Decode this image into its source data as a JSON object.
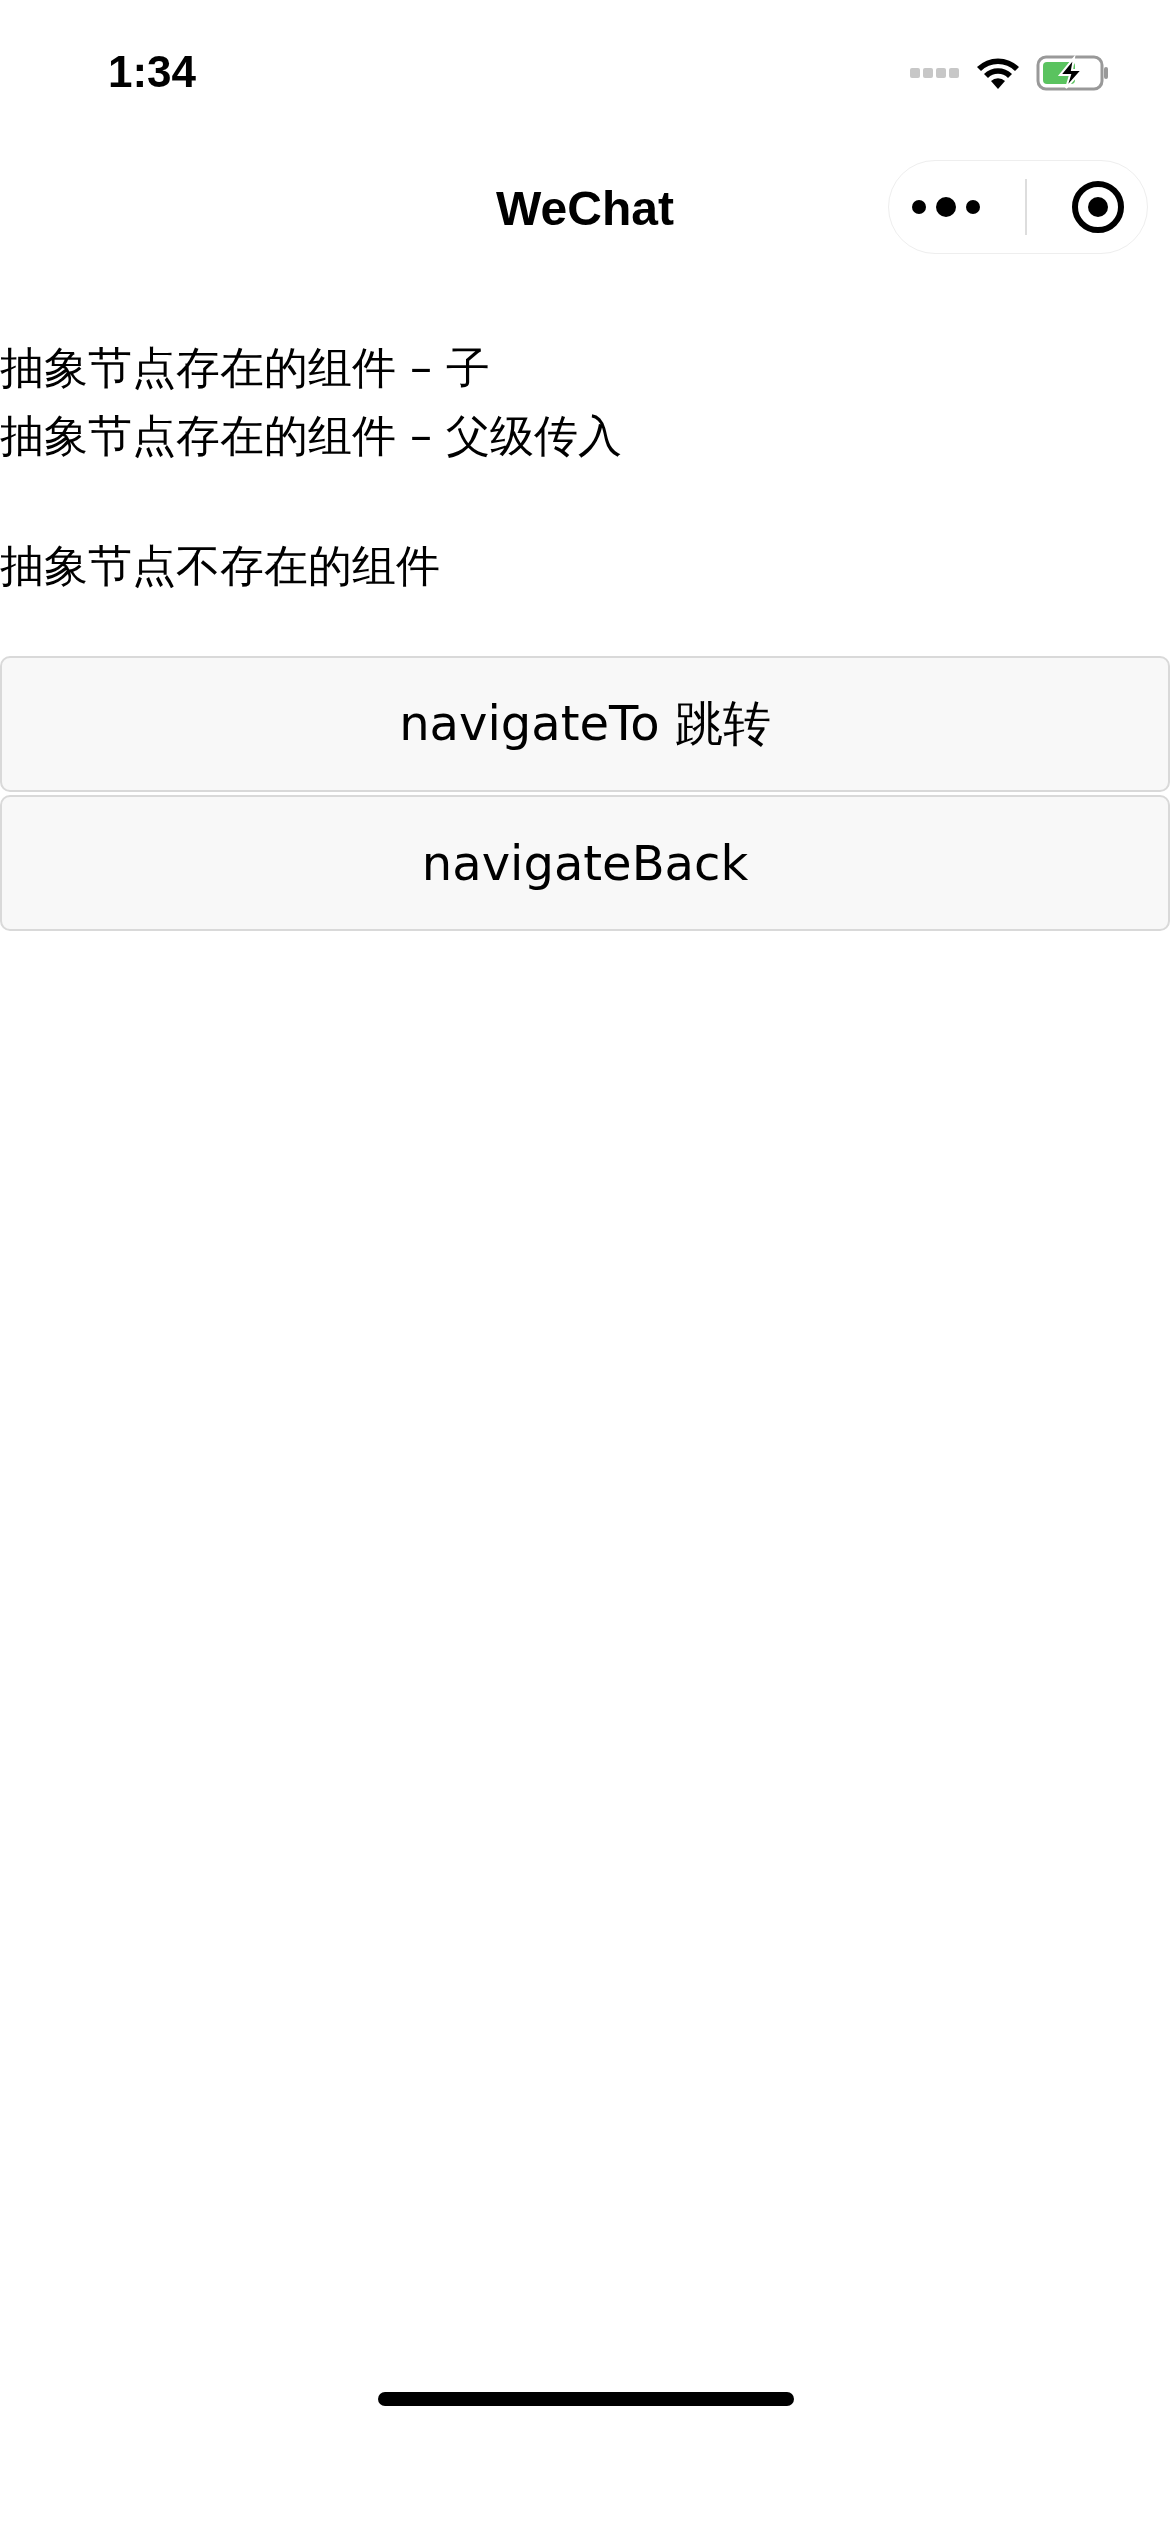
{
  "status_bar": {
    "time": "1:34"
  },
  "nav_bar": {
    "title": "WeChat"
  },
  "texts": [
    {
      "text": "抽象节点存在的组件 – 子"
    },
    {
      "text": "抽象节点存在的组件 – 父级传入"
    },
    {
      "text": "抽象节点不存在的组件"
    }
  ],
  "buttons": [
    {
      "label": "navigateTo 跳转"
    },
    {
      "label": "navigateBack"
    }
  ]
}
